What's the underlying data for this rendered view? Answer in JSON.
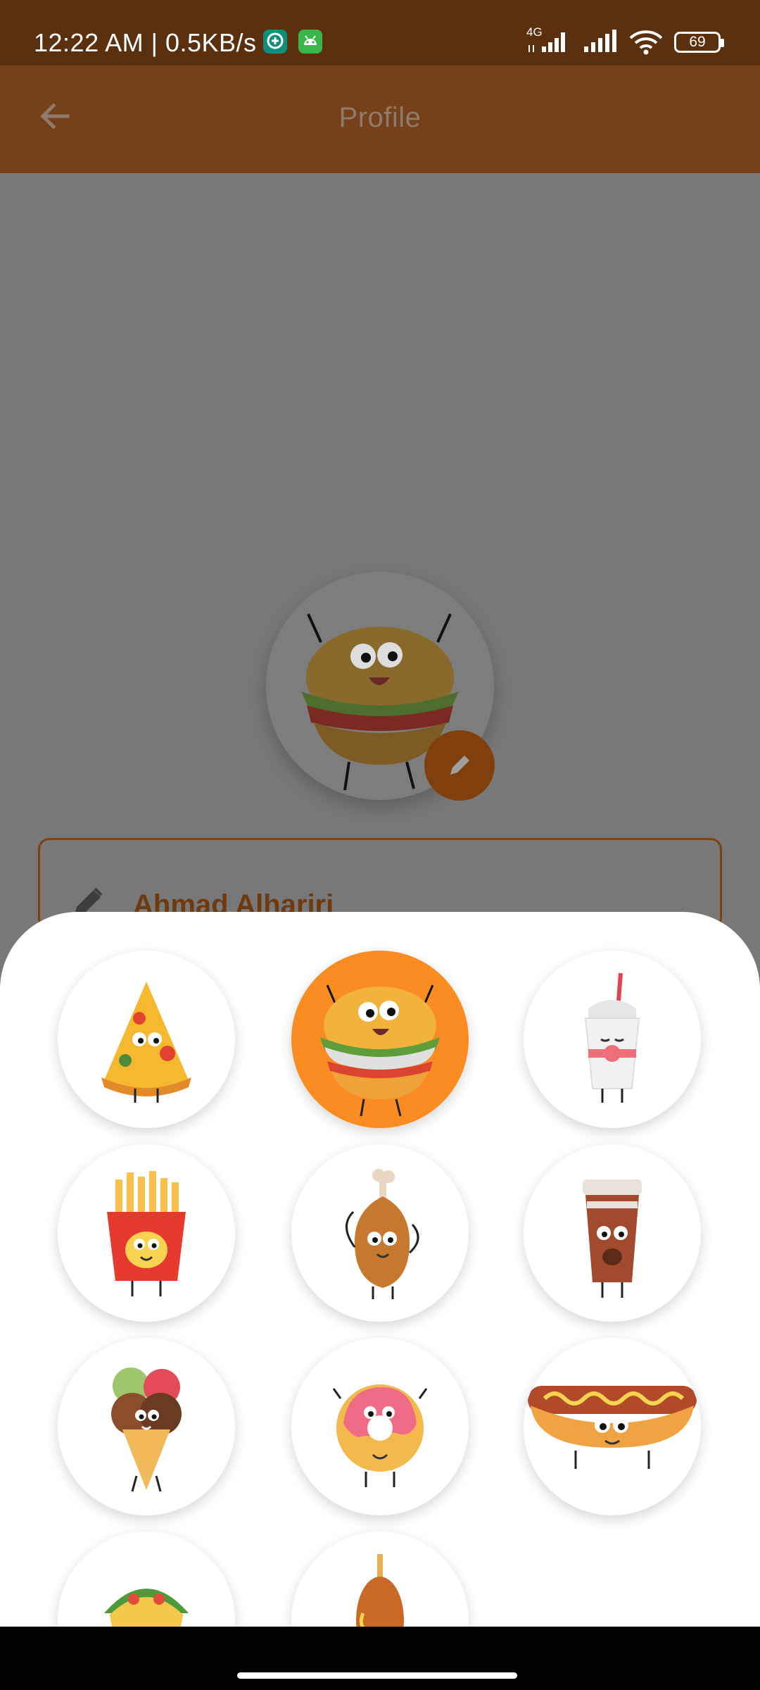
{
  "status_bar": {
    "time": "12:22 AM | 0.5KB/s",
    "network": "4G",
    "battery": "69",
    "icons": [
      "chat-app-icon",
      "android-app-icon",
      "signal-4g-icon",
      "signal-icon",
      "wifi-icon",
      "battery-icon"
    ]
  },
  "app_bar": {
    "title": "Profile",
    "back_icon": "arrow-left-icon"
  },
  "profile": {
    "avatar": "burger",
    "name": "Ahmad Alhariri",
    "edit_icon": "pencil-icon"
  },
  "colors": {
    "status_bar": "#5a300f",
    "app_bar": "#764018",
    "accent": "#7f400d",
    "selected": "#fb8c22"
  },
  "avatar_picker": {
    "selected": "burger",
    "options": [
      "pizza",
      "burger",
      "soda",
      "fries",
      "chicken-drumstick",
      "coffee-cup",
      "ice-cream",
      "donut",
      "hot-dog",
      "taco",
      "corn-dog"
    ]
  }
}
